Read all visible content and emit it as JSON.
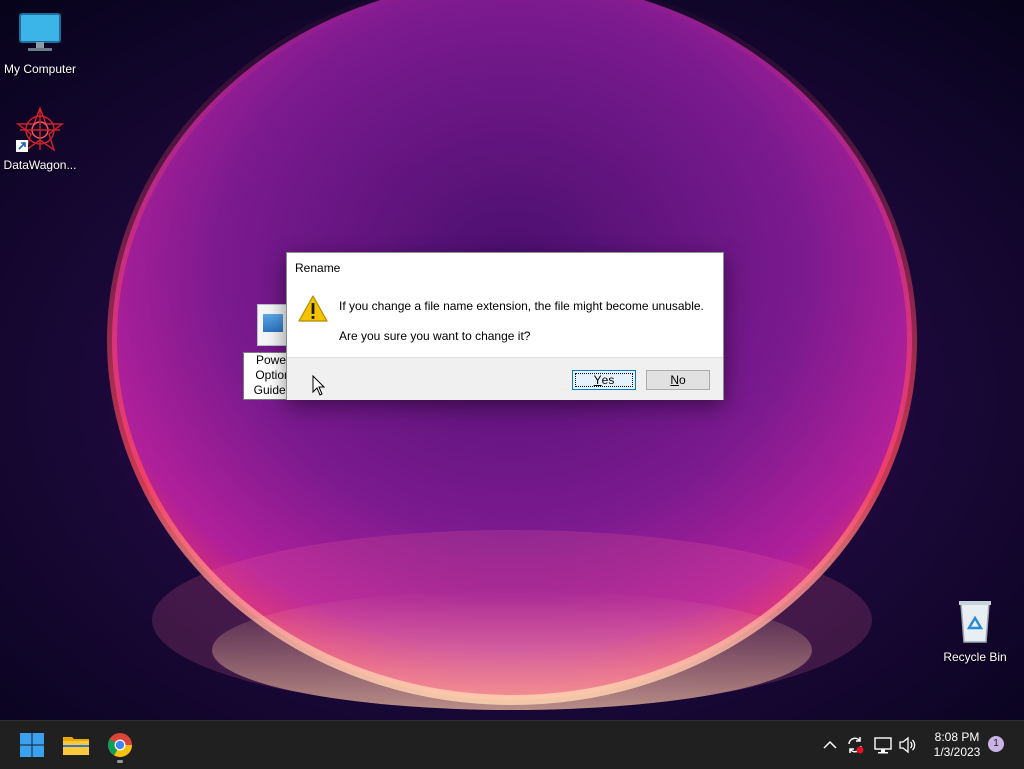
{
  "desktop": {
    "icons": [
      {
        "label": "My Computer",
        "icon": "monitor-icon"
      },
      {
        "label": "DataWagon...",
        "icon": "datawagon-icon"
      },
      {
        "label": "Recycle Bin",
        "icon": "recycle-bin-icon"
      }
    ],
    "file_rename": {
      "line1": "Power",
      "line2": "Option",
      "line3": "Guide.t",
      "icon": "image-file-icon"
    }
  },
  "dialog": {
    "title": "Rename",
    "icon": "warning-icon",
    "message1": "If you change a file name extension, the file might become unusable.",
    "message2": "Are you sure you want to change it?",
    "yes_mnemonic": "Y",
    "yes_rest": "es",
    "no_mnemonic": "N",
    "no_rest": "o"
  },
  "taskbar": {
    "apps": [
      "windows-start-icon",
      "file-explorer-icon",
      "chrome-icon"
    ],
    "tray_icons": [
      "chevron-up-icon",
      "sync-icon",
      "network-icon",
      "volume-icon"
    ],
    "time": "8:08 PM",
    "date": "1/3/2023",
    "notification_count": "1"
  },
  "colors": {
    "accent": "#0078d7",
    "taskbar": "#202020",
    "warning": "#f5c400"
  }
}
